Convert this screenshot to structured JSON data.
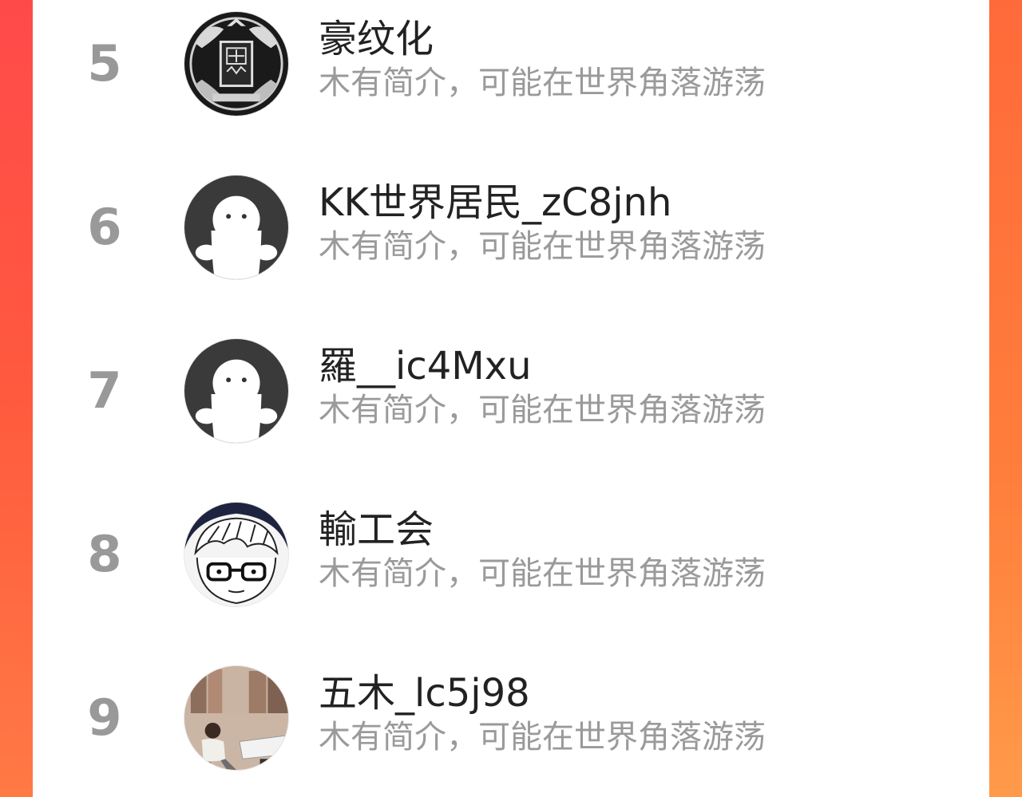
{
  "colors": {
    "background_left": "#ff4a4a",
    "background_right": "#ff8a45",
    "panel": "#ffffff",
    "rank": "#999999",
    "name": "#222222",
    "bio": "#9a9a9a"
  },
  "list": {
    "items": [
      {
        "rank": "5",
        "name": "豪纹化",
        "bio": "木有简介，可能在世界角落游荡",
        "avatar": "seal-avatar"
      },
      {
        "rank": "6",
        "name": "KK世界居民_zC8jnh",
        "bio": "木有简介，可能在世界角落游荡",
        "avatar": "default-ghost-avatar"
      },
      {
        "rank": "7",
        "name": "羅__ic4Mxu",
        "bio": "木有简介，可能在世界角落游荡",
        "avatar": "default-ghost-avatar"
      },
      {
        "rank": "8",
        "name": "輸工会",
        "bio": "木有简介，可能在世界角落游荡",
        "avatar": "cartoon-glasses-avatar"
      },
      {
        "rank": "9",
        "name": "五木_lc5j98",
        "bio": "木有简介，可能在世界角落游荡",
        "avatar": "street-photo-avatar"
      }
    ]
  }
}
